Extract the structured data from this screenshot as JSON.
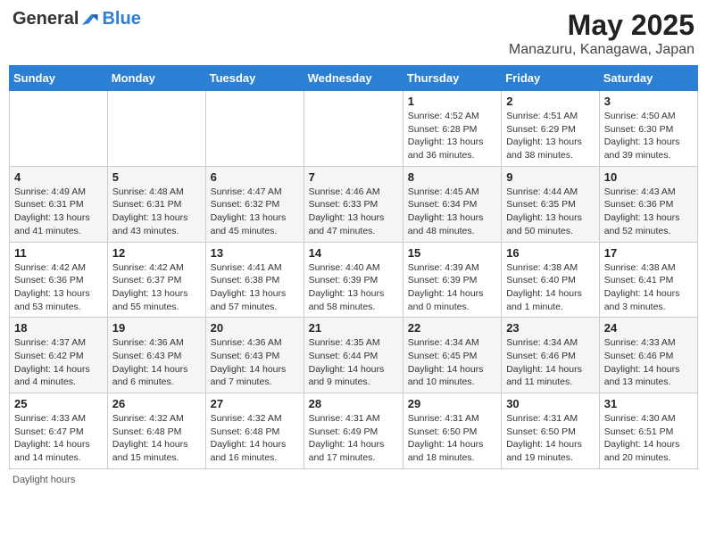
{
  "header": {
    "logo_general": "General",
    "logo_blue": "Blue",
    "month_year": "May 2025",
    "location": "Manazuru, Kanagawa, Japan"
  },
  "weekdays": [
    "Sunday",
    "Monday",
    "Tuesday",
    "Wednesday",
    "Thursday",
    "Friday",
    "Saturday"
  ],
  "weeks": [
    [
      {
        "day": "",
        "info": ""
      },
      {
        "day": "",
        "info": ""
      },
      {
        "day": "",
        "info": ""
      },
      {
        "day": "",
        "info": ""
      },
      {
        "day": "1",
        "info": "Sunrise: 4:52 AM\nSunset: 6:28 PM\nDaylight: 13 hours and 36 minutes."
      },
      {
        "day": "2",
        "info": "Sunrise: 4:51 AM\nSunset: 6:29 PM\nDaylight: 13 hours and 38 minutes."
      },
      {
        "day": "3",
        "info": "Sunrise: 4:50 AM\nSunset: 6:30 PM\nDaylight: 13 hours and 39 minutes."
      }
    ],
    [
      {
        "day": "4",
        "info": "Sunrise: 4:49 AM\nSunset: 6:31 PM\nDaylight: 13 hours and 41 minutes."
      },
      {
        "day": "5",
        "info": "Sunrise: 4:48 AM\nSunset: 6:31 PM\nDaylight: 13 hours and 43 minutes."
      },
      {
        "day": "6",
        "info": "Sunrise: 4:47 AM\nSunset: 6:32 PM\nDaylight: 13 hours and 45 minutes."
      },
      {
        "day": "7",
        "info": "Sunrise: 4:46 AM\nSunset: 6:33 PM\nDaylight: 13 hours and 47 minutes."
      },
      {
        "day": "8",
        "info": "Sunrise: 4:45 AM\nSunset: 6:34 PM\nDaylight: 13 hours and 48 minutes."
      },
      {
        "day": "9",
        "info": "Sunrise: 4:44 AM\nSunset: 6:35 PM\nDaylight: 13 hours and 50 minutes."
      },
      {
        "day": "10",
        "info": "Sunrise: 4:43 AM\nSunset: 6:36 PM\nDaylight: 13 hours and 52 minutes."
      }
    ],
    [
      {
        "day": "11",
        "info": "Sunrise: 4:42 AM\nSunset: 6:36 PM\nDaylight: 13 hours and 53 minutes."
      },
      {
        "day": "12",
        "info": "Sunrise: 4:42 AM\nSunset: 6:37 PM\nDaylight: 13 hours and 55 minutes."
      },
      {
        "day": "13",
        "info": "Sunrise: 4:41 AM\nSunset: 6:38 PM\nDaylight: 13 hours and 57 minutes."
      },
      {
        "day": "14",
        "info": "Sunrise: 4:40 AM\nSunset: 6:39 PM\nDaylight: 13 hours and 58 minutes."
      },
      {
        "day": "15",
        "info": "Sunrise: 4:39 AM\nSunset: 6:39 PM\nDaylight: 14 hours and 0 minutes."
      },
      {
        "day": "16",
        "info": "Sunrise: 4:38 AM\nSunset: 6:40 PM\nDaylight: 14 hours and 1 minute."
      },
      {
        "day": "17",
        "info": "Sunrise: 4:38 AM\nSunset: 6:41 PM\nDaylight: 14 hours and 3 minutes."
      }
    ],
    [
      {
        "day": "18",
        "info": "Sunrise: 4:37 AM\nSunset: 6:42 PM\nDaylight: 14 hours and 4 minutes."
      },
      {
        "day": "19",
        "info": "Sunrise: 4:36 AM\nSunset: 6:43 PM\nDaylight: 14 hours and 6 minutes."
      },
      {
        "day": "20",
        "info": "Sunrise: 4:36 AM\nSunset: 6:43 PM\nDaylight: 14 hours and 7 minutes."
      },
      {
        "day": "21",
        "info": "Sunrise: 4:35 AM\nSunset: 6:44 PM\nDaylight: 14 hours and 9 minutes."
      },
      {
        "day": "22",
        "info": "Sunrise: 4:34 AM\nSunset: 6:45 PM\nDaylight: 14 hours and 10 minutes."
      },
      {
        "day": "23",
        "info": "Sunrise: 4:34 AM\nSunset: 6:46 PM\nDaylight: 14 hours and 11 minutes."
      },
      {
        "day": "24",
        "info": "Sunrise: 4:33 AM\nSunset: 6:46 PM\nDaylight: 14 hours and 13 minutes."
      }
    ],
    [
      {
        "day": "25",
        "info": "Sunrise: 4:33 AM\nSunset: 6:47 PM\nDaylight: 14 hours and 14 minutes."
      },
      {
        "day": "26",
        "info": "Sunrise: 4:32 AM\nSunset: 6:48 PM\nDaylight: 14 hours and 15 minutes."
      },
      {
        "day": "27",
        "info": "Sunrise: 4:32 AM\nSunset: 6:48 PM\nDaylight: 14 hours and 16 minutes."
      },
      {
        "day": "28",
        "info": "Sunrise: 4:31 AM\nSunset: 6:49 PM\nDaylight: 14 hours and 17 minutes."
      },
      {
        "day": "29",
        "info": "Sunrise: 4:31 AM\nSunset: 6:50 PM\nDaylight: 14 hours and 18 minutes."
      },
      {
        "day": "30",
        "info": "Sunrise: 4:31 AM\nSunset: 6:50 PM\nDaylight: 14 hours and 19 minutes."
      },
      {
        "day": "31",
        "info": "Sunrise: 4:30 AM\nSunset: 6:51 PM\nDaylight: 14 hours and 20 minutes."
      }
    ]
  ],
  "footer": "Daylight hours"
}
